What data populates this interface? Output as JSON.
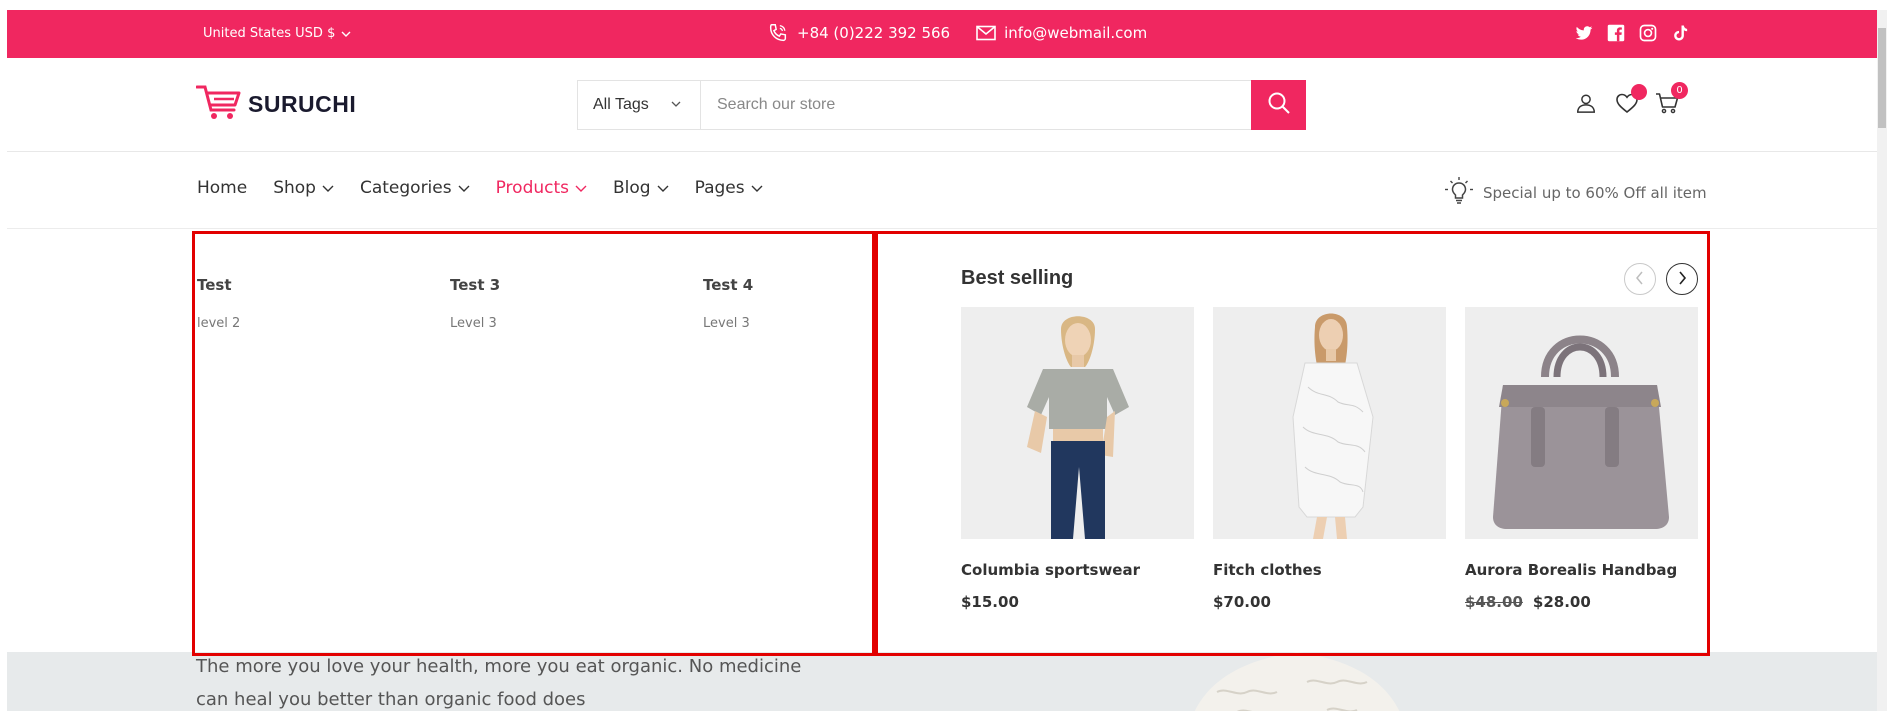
{
  "topbar": {
    "currency": "United States USD $",
    "phone": "+84 (0)222 392 566",
    "email": "info@webmail.com",
    "socials": [
      "twitter-icon",
      "facebook-icon",
      "instagram-icon",
      "tiktok-icon"
    ]
  },
  "header": {
    "logo_text": "SURUCHI",
    "search": {
      "category": "All Tags",
      "placeholder": "Search our store"
    },
    "cart_count": "0"
  },
  "nav": {
    "items": [
      {
        "label": "Home",
        "dropdown": false
      },
      {
        "label": "Shop",
        "dropdown": true
      },
      {
        "label": "Categories",
        "dropdown": true
      },
      {
        "label": "Products",
        "dropdown": true,
        "active": true
      },
      {
        "label": "Blog",
        "dropdown": true
      },
      {
        "label": "Pages",
        "dropdown": true
      }
    ],
    "promo": "Special up to 60% Off all item"
  },
  "mega_menu": {
    "columns": [
      {
        "title": "Test",
        "sub": "level 2"
      },
      {
        "title": "Test 3",
        "sub": "Level 3"
      },
      {
        "title": "Test 4",
        "sub": "Level 3"
      }
    ],
    "best_selling": {
      "title": "Best selling",
      "products": [
        {
          "name": "Columbia sportswear",
          "price": "$15.00",
          "old_price": ""
        },
        {
          "name": "Fitch clothes",
          "price": "$70.00",
          "old_price": ""
        },
        {
          "name": "Aurora Borealis Handbag",
          "price": "$28.00",
          "old_price": "$48.00"
        }
      ]
    }
  },
  "banner": {
    "text": "The more you love your health, more you eat organic. No medicine can heal you better than organic food does"
  },
  "colors": {
    "brand": "#f02760",
    "highlight": "#e20000"
  }
}
